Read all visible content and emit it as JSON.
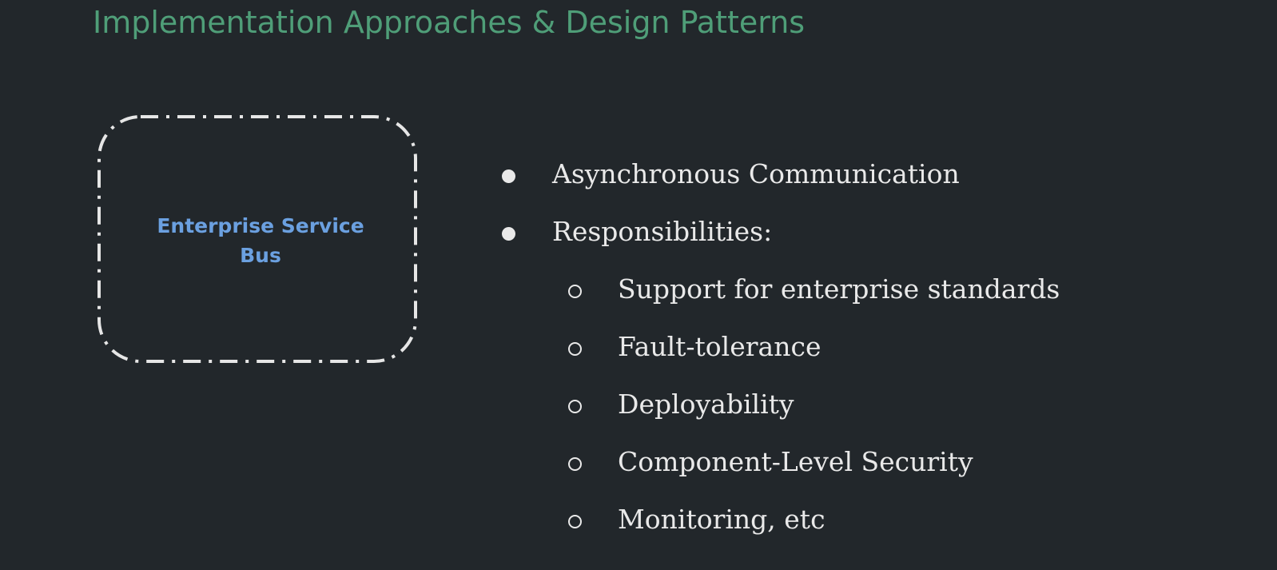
{
  "slide": {
    "title": "Implementation Approaches & Design Patterns"
  },
  "diagram": {
    "box_label": "Enterprise Service Bus"
  },
  "bullets": {
    "items": [
      {
        "text": "Asynchronous Communication",
        "level": 1
      },
      {
        "text": "Responsibilities:",
        "level": 1
      }
    ],
    "subitems": [
      {
        "text": "Support for enterprise standards",
        "level": 2
      },
      {
        "text": "Fault-tolerance",
        "level": 2
      },
      {
        "text": "Deployability",
        "level": 2
      },
      {
        "text": "Component-Level Security",
        "level": 2
      },
      {
        "text": "Monitoring, etc",
        "level": 2
      }
    ]
  },
  "colors": {
    "background": "#22272b",
    "title": "#4f9e78",
    "box_label": "#6ba0e0",
    "box_border": "#e6e6e6",
    "text": "#e9e9e9"
  }
}
